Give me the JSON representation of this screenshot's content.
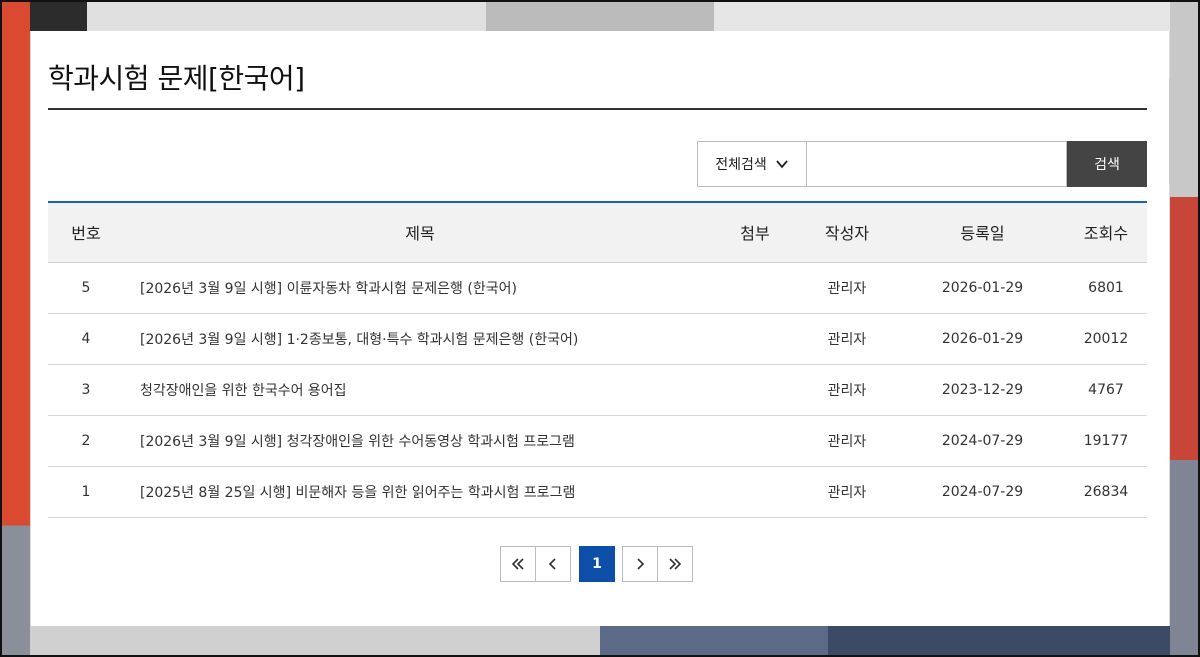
{
  "page": {
    "title": "학과시험 문제[한국어]"
  },
  "search": {
    "scope_selected": "전체검색",
    "input_value": "",
    "button_label": "검색"
  },
  "table": {
    "columns": [
      "번호",
      "제목",
      "첨부",
      "작성자",
      "등록일",
      "조회수"
    ],
    "rows": [
      {
        "no": "5",
        "subject": "[2026년 3월 9일 시행] 이륜자동차 학과시험 문제은행 (한국어)",
        "attach": "",
        "writer": "관리자",
        "date": "2026-01-29",
        "views": "6801"
      },
      {
        "no": "4",
        "subject": "[2026년 3월 9일 시행] 1·2종보통, 대형·특수 학과시험 문제은행 (한국어)",
        "attach": "",
        "writer": "관리자",
        "date": "2026-01-29",
        "views": "20012"
      },
      {
        "no": "3",
        "subject": "청각장애인을 위한 한국수어 용어집",
        "attach": "",
        "writer": "관리자",
        "date": "2023-12-29",
        "views": "4767"
      },
      {
        "no": "2",
        "subject": "[2026년 3월 9일 시행] 청각장애인을 위한 수어동영상 학과시험 프로그램",
        "attach": "",
        "writer": "관리자",
        "date": "2024-07-29",
        "views": "19177"
      },
      {
        "no": "1",
        "subject": "[2025년 8월 25일 시행] 비문해자 등을 위한 읽어주는 학과시험 프로그램",
        "attach": "",
        "writer": "관리자",
        "date": "2024-07-29",
        "views": "26834"
      }
    ]
  },
  "pagination": {
    "current": "1",
    "first_icon": "double-chevron-left-icon",
    "prev_icon": "chevron-left-icon",
    "next_icon": "chevron-right-icon",
    "last_icon": "double-chevron-right-icon"
  },
  "colors": {
    "accent": "#1f5fb4",
    "current_page": "#0d4fa8",
    "search_button": "#444444"
  }
}
